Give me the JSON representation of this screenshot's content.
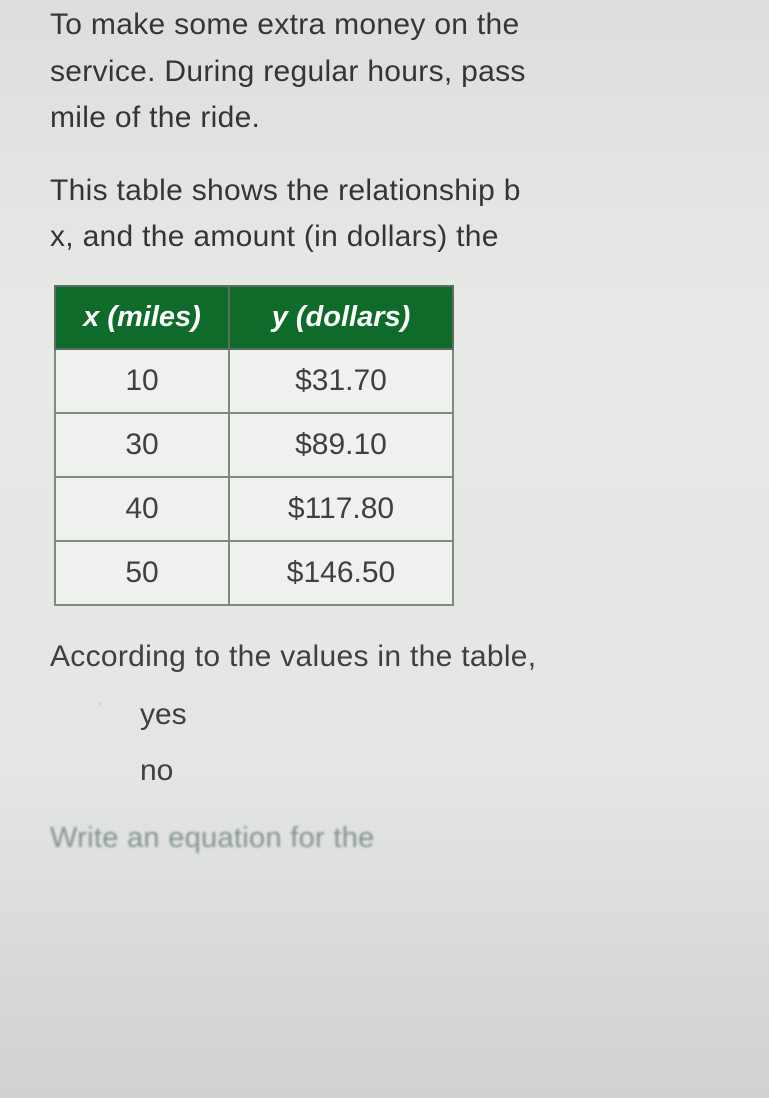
{
  "intro": {
    "line1": "To make some extra money on the",
    "line2": "service. During regular hours, pass",
    "line3": "mile of the ride."
  },
  "lead": {
    "line1": "This table shows the relationship b",
    "line2": "x, and the amount (in dollars) the "
  },
  "table": {
    "header_x": "x (miles)",
    "header_y": "y (dollars)",
    "rows": [
      {
        "x": "10",
        "y": "$31.70"
      },
      {
        "x": "30",
        "y": "$89.10"
      },
      {
        "x": "40",
        "y": "$117.80"
      },
      {
        "x": "50",
        "y": "$146.50"
      }
    ]
  },
  "according": "According to the values in the table,",
  "options": {
    "yes": "yes",
    "no": "no"
  },
  "write_eq": "Write an equation for the"
}
